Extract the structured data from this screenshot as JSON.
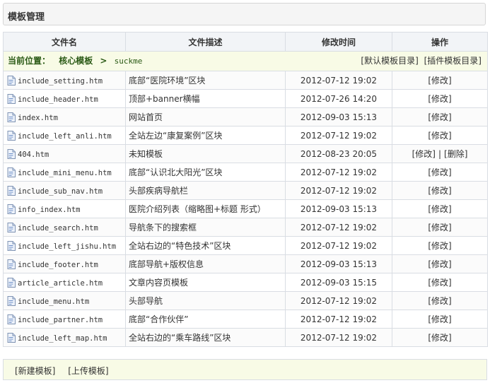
{
  "header": {
    "title": "模板管理"
  },
  "table": {
    "columns": [
      "文件名",
      "文件描述",
      "修改时间",
      "操作"
    ],
    "path": {
      "label": "当前位置：",
      "crumbs": [
        "核心模板",
        "suckme"
      ],
      "separator": ">",
      "links": [
        "[默认模板目录]",
        "[插件模板目录]"
      ]
    },
    "rows": [
      {
        "name": "include_setting.htm",
        "desc": "底部“医院环境”区块",
        "time": "2012-07-12 19:02",
        "ops": [
          "[修改]"
        ]
      },
      {
        "name": "include_header.htm",
        "desc": "顶部+banner横幅",
        "time": "2012-07-26 14:20",
        "ops": [
          "[修改]"
        ]
      },
      {
        "name": "index.htm",
        "desc": "网站首页",
        "time": "2012-09-03 15:13",
        "ops": [
          "[修改]"
        ]
      },
      {
        "name": "include_left_anli.htm",
        "desc": "全站左边“康复案例”区块",
        "time": "2012-07-12 19:02",
        "ops": [
          "[修改]"
        ]
      },
      {
        "name": "404.htm",
        "desc": "未知模板",
        "time": "2012-08-23 20:05",
        "ops": [
          "[修改]",
          "[删除]"
        ]
      },
      {
        "name": "include_mini_menu.htm",
        "desc": "底部“认识北大阳光”区块",
        "time": "2012-07-12 19:02",
        "ops": [
          "[修改]"
        ]
      },
      {
        "name": "include_sub_nav.htm",
        "desc": "头部疾病导航栏",
        "time": "2012-07-12 19:02",
        "ops": [
          "[修改]"
        ]
      },
      {
        "name": "info_index.htm",
        "desc": "医院介绍列表（缩略图+标题 形式）",
        "time": "2012-09-03 15:13",
        "ops": [
          "[修改]"
        ]
      },
      {
        "name": "include_search.htm",
        "desc": "导航条下的搜索框",
        "time": "2012-07-12 19:02",
        "ops": [
          "[修改]"
        ]
      },
      {
        "name": "include_left_jishu.htm",
        "desc": "全站右边的“特色技术”区块",
        "time": "2012-07-12 19:02",
        "ops": [
          "[修改]"
        ]
      },
      {
        "name": "include_footer.htm",
        "desc": "底部导航+版权信息",
        "time": "2012-09-03 15:13",
        "ops": [
          "[修改]"
        ]
      },
      {
        "name": "article_article.htm",
        "desc": "文章内容页模板",
        "time": "2012-09-03 15:15",
        "ops": [
          "[修改]"
        ]
      },
      {
        "name": "include_menu.htm",
        "desc": "头部导航",
        "time": "2012-07-12 19:02",
        "ops": [
          "[修改]"
        ]
      },
      {
        "name": "include_partner.htm",
        "desc": "底部“合作伙伴”",
        "time": "2012-07-12 19:02",
        "ops": [
          "[修改]"
        ]
      },
      {
        "name": "include_left_map.htm",
        "desc": "全站右边的“乘车路线”区块",
        "time": "2012-07-12 19:02",
        "ops": [
          "[修改]"
        ]
      }
    ],
    "ops_separator": "|",
    "file_icon": "file-icon"
  },
  "footer": {
    "buttons": [
      "[新建模板]",
      "[上传模板]"
    ]
  }
}
